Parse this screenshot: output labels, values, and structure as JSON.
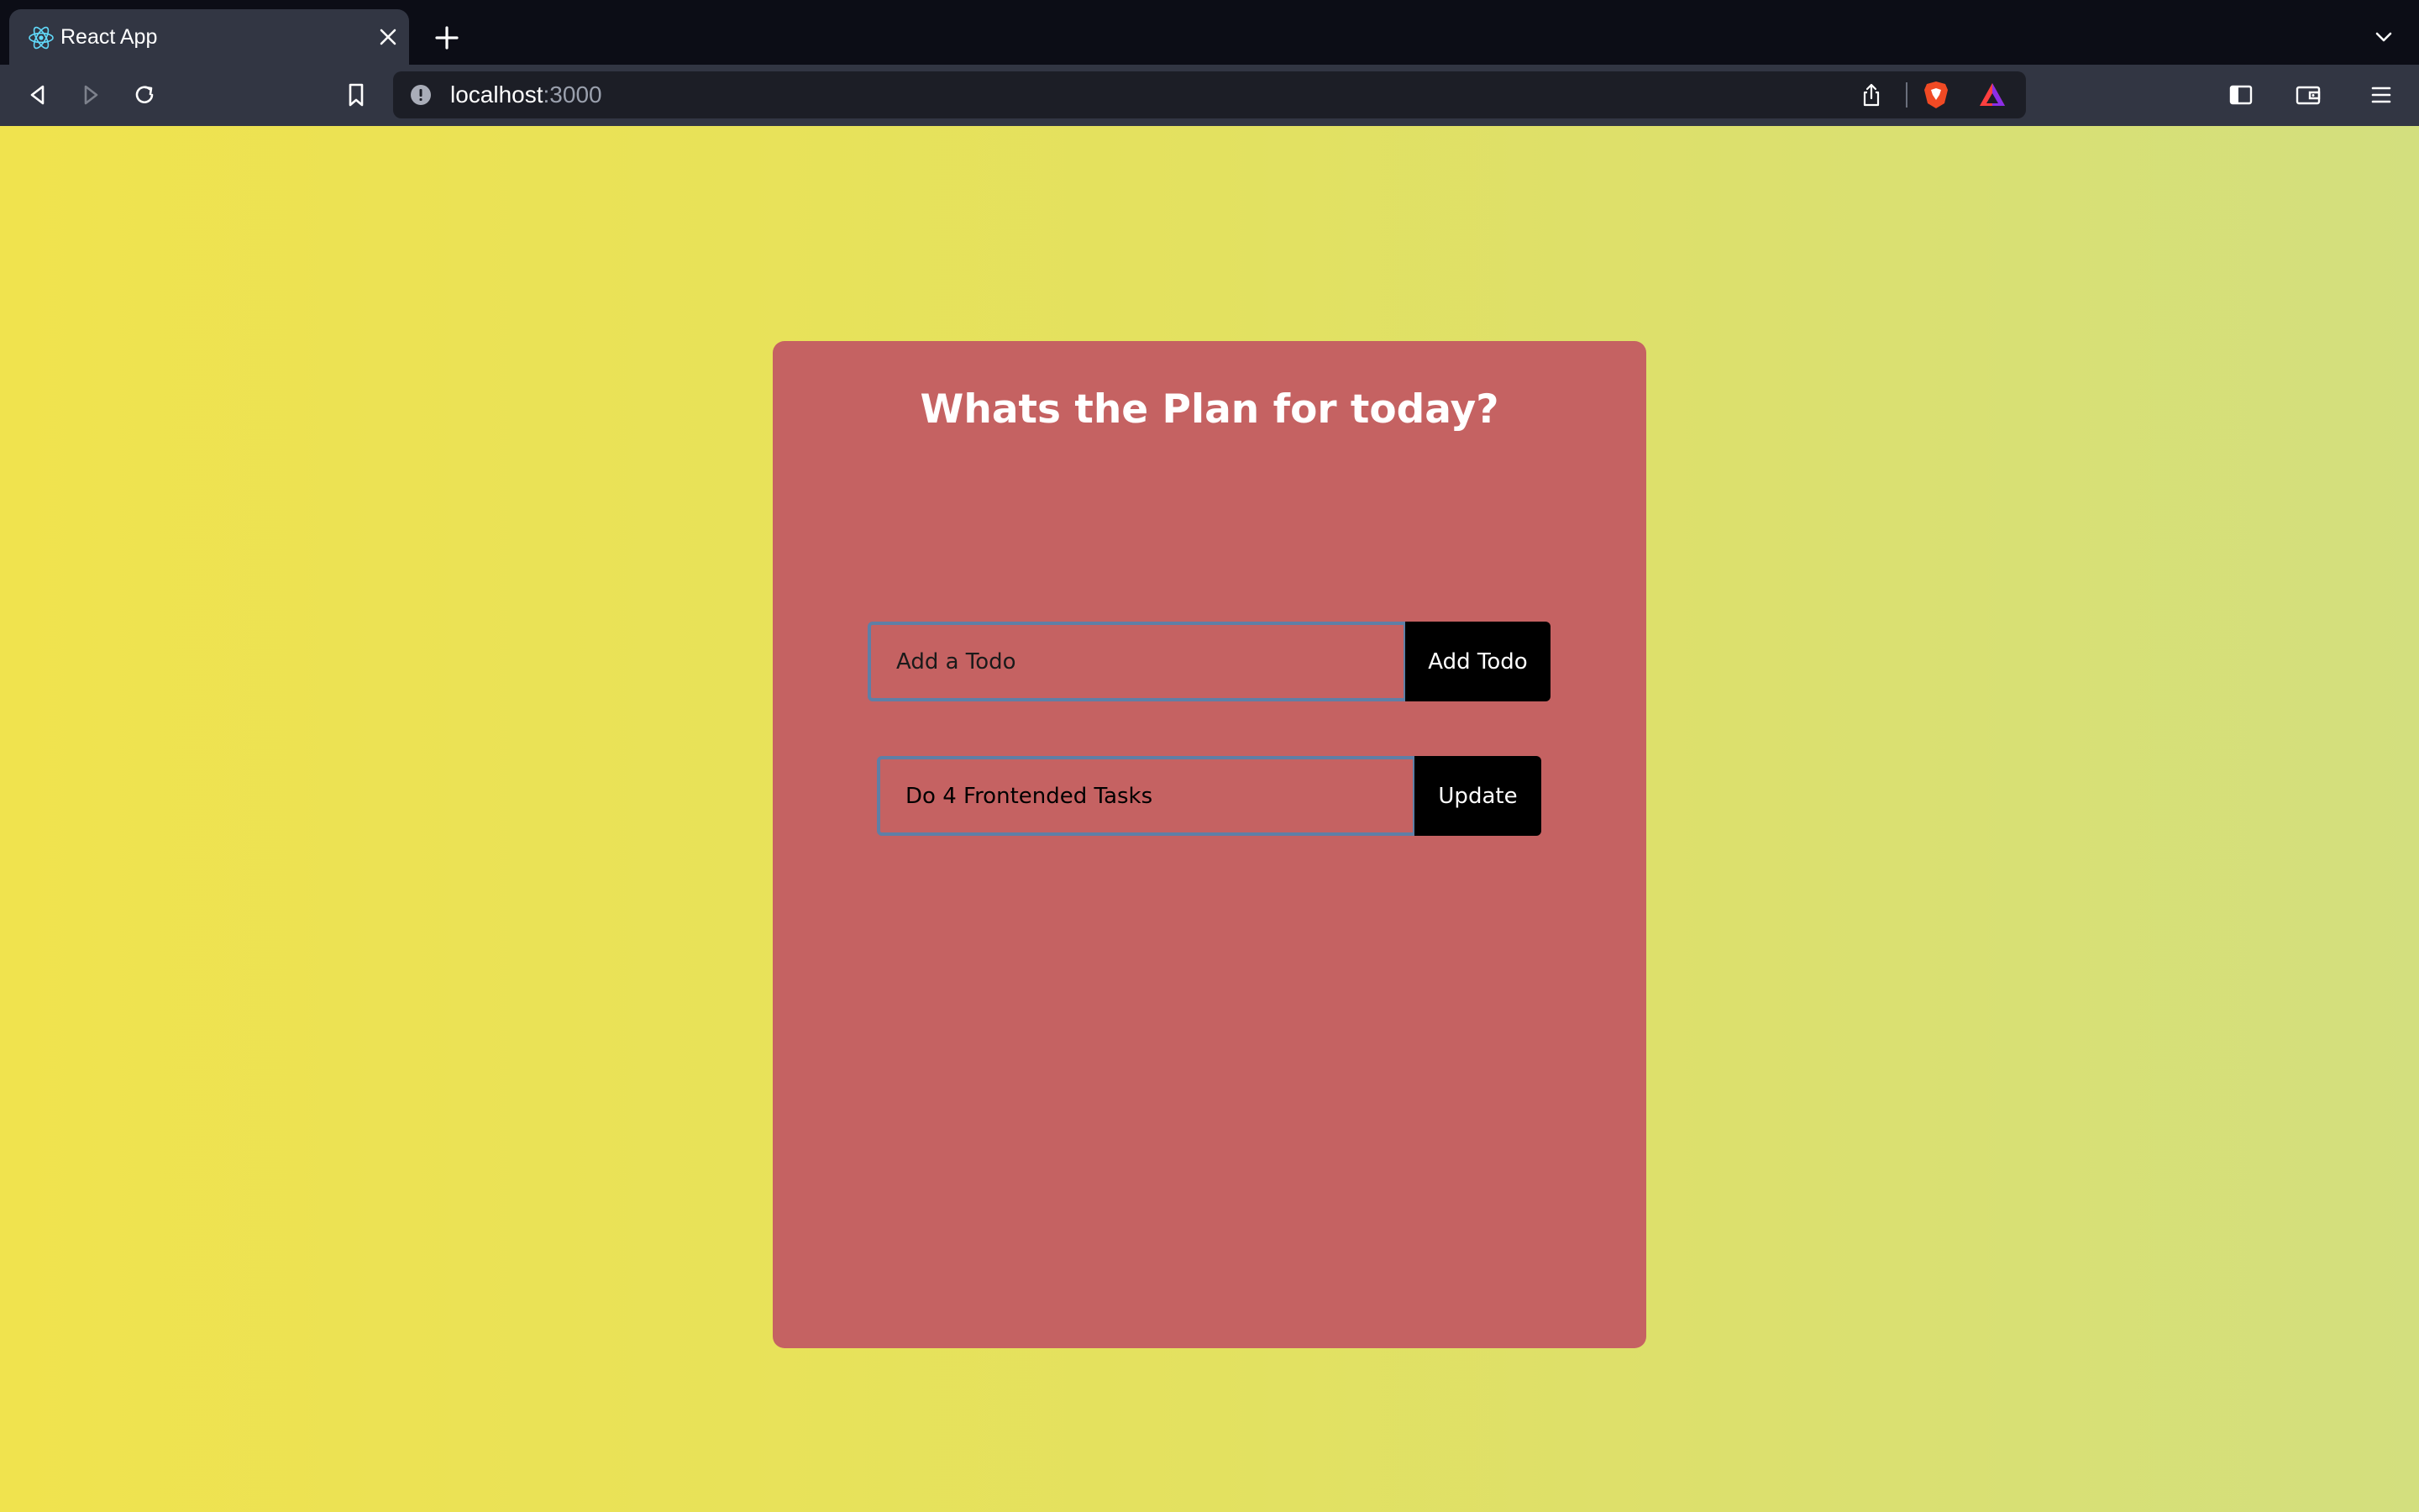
{
  "browser": {
    "tab": {
      "title": "React App",
      "favicon": "react-icon"
    },
    "url": {
      "host": "localhost",
      "port": ":3000"
    },
    "icons": [
      "back-icon",
      "forward-icon",
      "reload-icon",
      "bookmark-icon",
      "info-icon",
      "share-icon",
      "brave-shields-icon",
      "brave-rewards-icon",
      "sidebar-icon",
      "wallet-icon",
      "menu-icon"
    ]
  },
  "app": {
    "title": "Whats the Plan for today?",
    "add_form": {
      "placeholder": "Add a Todo",
      "value": "",
      "button_label": "Add Todo"
    },
    "edit_form": {
      "value": "Do 4 Frontended Tasks",
      "button_label": "Update"
    }
  },
  "colors": {
    "card": "#c56262",
    "background_start": "#f0e34e",
    "background_end": "#d3df7e",
    "button": "#000000",
    "input_border": "#5f7fa6"
  }
}
